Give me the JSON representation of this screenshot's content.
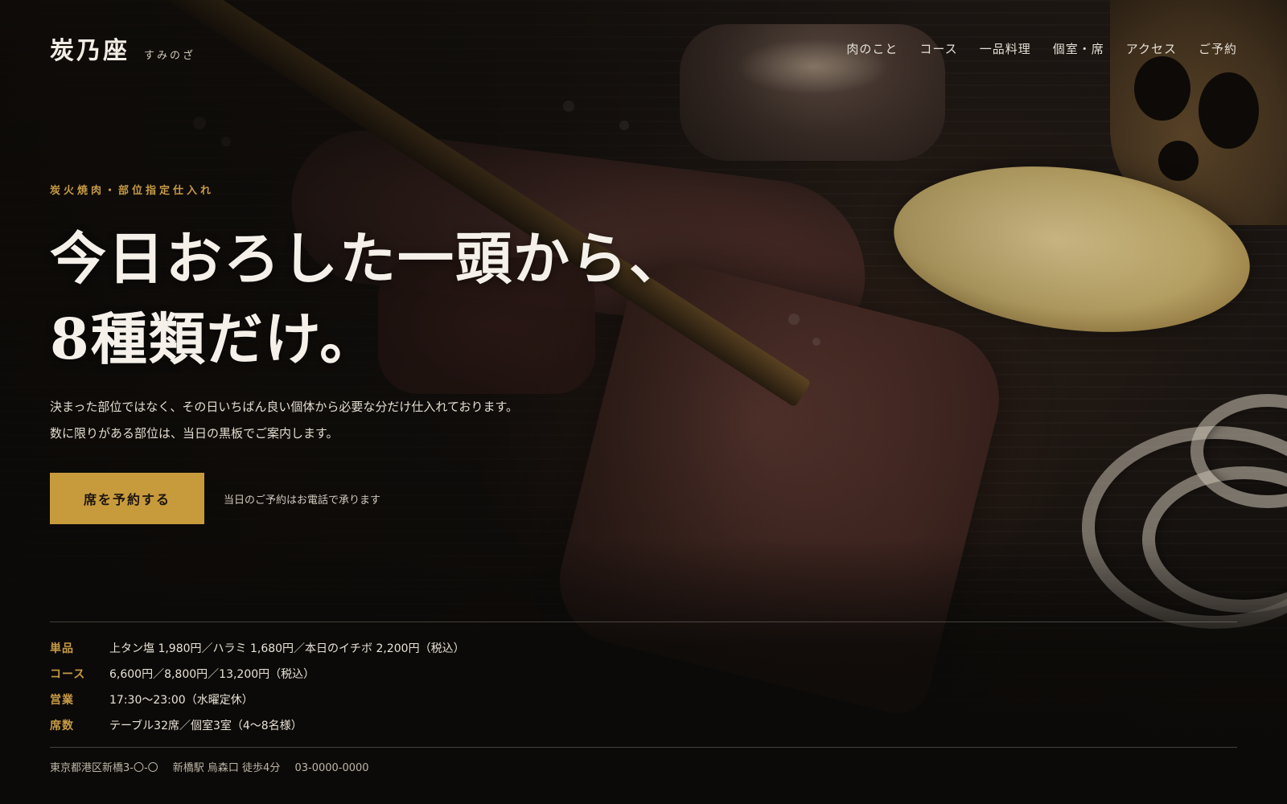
{
  "brand": {
    "name": "炭乃座",
    "reading": "すみのざ"
  },
  "nav": {
    "items": [
      {
        "label": "肉のこと"
      },
      {
        "label": "コース"
      },
      {
        "label": "一品料理"
      },
      {
        "label": "個室・席"
      },
      {
        "label": "アクセス"
      },
      {
        "label": "ご予約"
      }
    ]
  },
  "hero": {
    "eyebrow": "炭火焼肉・部位指定仕入れ",
    "headline_line1": "今日おろした一頭から、",
    "headline_line2": "8種類だけ。",
    "lead_line1": "決まった部位ではなく、その日いちばん良い個体から必要な分だけ仕入れております。",
    "lead_line2": "数に限りがある部位は、当日の黒板でご案内します。",
    "cta_label": "席を予約する",
    "cta_note": "当日のご予約はお電話で承ります"
  },
  "info": {
    "rows": [
      {
        "label": "単品",
        "value": "上タン塩 1,980円／ハラミ 1,680円／本日のイチボ 2,200円（税込）"
      },
      {
        "label": "コース",
        "value": "6,600円／8,800円／13,200円（税込）"
      },
      {
        "label": "営業",
        "value": "17:30〜23:00（水曜定休）"
      },
      {
        "label": "席数",
        "value": "テーブル32席／個室3室（4〜8名様）"
      }
    ]
  },
  "footer": {
    "address": "東京都港区新橋3-〇-〇",
    "station": "新橋駅 烏森口 徒歩4分",
    "phone": "03-0000-0000"
  },
  "colors": {
    "accent": "#c79a3c",
    "background": "#120f0c",
    "text": "#ece6dc"
  }
}
